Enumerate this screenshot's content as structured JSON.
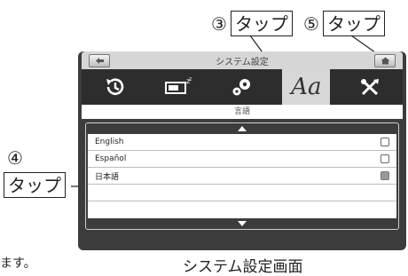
{
  "callouts": {
    "c3": {
      "num": "③",
      "label": "タップ"
    },
    "c5": {
      "num": "⑤",
      "label": "タップ"
    },
    "c4": {
      "num": "④",
      "label": "タップ"
    }
  },
  "screen": {
    "title": "システム設定",
    "tabs": [
      "clock-icon",
      "battery-icon",
      "gears-icon",
      "Aa",
      "tools-icon"
    ],
    "section_label": "言語",
    "languages": [
      {
        "label": "English",
        "checked": false
      },
      {
        "label": "Español",
        "checked": false
      },
      {
        "label": "日本語",
        "checked": true
      },
      {
        "label": "",
        "checked": null
      },
      {
        "label": "",
        "checked": null
      }
    ]
  },
  "left_fragment": "ます。",
  "caption": "システム設定画面"
}
